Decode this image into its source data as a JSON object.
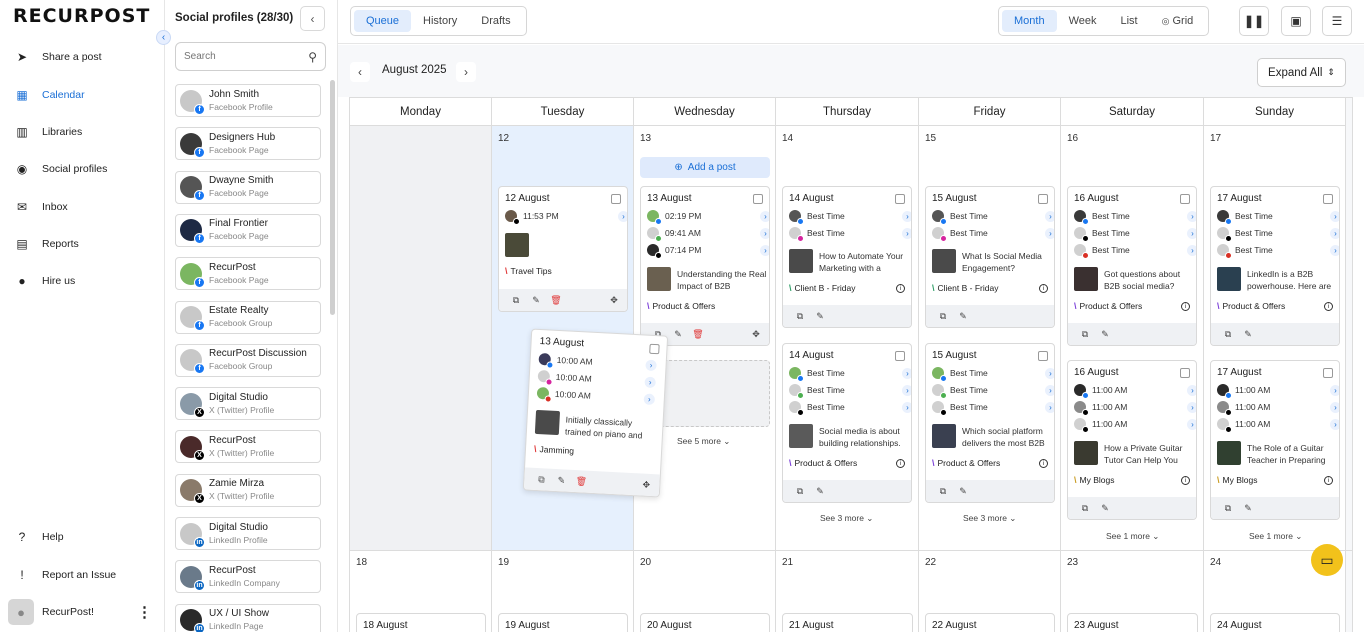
{
  "app": {
    "logo": "RECURPOST"
  },
  "nav": {
    "items": [
      {
        "label": "Share a post",
        "icon": "send-icon"
      },
      {
        "label": "Calendar",
        "icon": "calendar-icon"
      },
      {
        "label": "Libraries",
        "icon": "library-icon"
      },
      {
        "label": "Social profiles",
        "icon": "profile-icon"
      },
      {
        "label": "Inbox",
        "icon": "inbox-icon"
      },
      {
        "label": "Reports",
        "icon": "reports-icon"
      },
      {
        "label": "Hire us",
        "icon": "person-icon"
      }
    ],
    "bottom": [
      {
        "label": "Help",
        "icon": "help-icon"
      },
      {
        "label": "Report an Issue",
        "icon": "report-issue-icon"
      }
    ],
    "user": "RecurPost!",
    "accent": "#1a6fd6"
  },
  "profiles": {
    "title": "Social profiles (28/30)",
    "search_placeholder": "Search",
    "items": [
      {
        "name": "John Smith",
        "type": "Facebook Profile"
      },
      {
        "name": "Designers Hub",
        "type": "Facebook Page"
      },
      {
        "name": "Dwayne Smith",
        "type": "Facebook Page"
      },
      {
        "name": "Final Frontier",
        "type": "Facebook Page"
      },
      {
        "name": "RecurPost",
        "type": "Facebook Page"
      },
      {
        "name": "Estate Realty",
        "type": "Facebook Group"
      },
      {
        "name": "RecurPost Discussion",
        "type": "Facebook Group"
      },
      {
        "name": "Digital Studio",
        "type": "X (Twitter) Profile"
      },
      {
        "name": "RecurPost",
        "type": "X (Twitter) Profile"
      },
      {
        "name": "Zamie Mirza",
        "type": "X (Twitter) Profile"
      },
      {
        "name": "Digital Studio",
        "type": "LinkedIn Profile"
      },
      {
        "name": "RecurPost",
        "type": "LinkedIn Company"
      },
      {
        "name": "UX / UI Show",
        "type": "LinkedIn Page"
      }
    ]
  },
  "topbar": {
    "tabs": [
      "Queue",
      "History",
      "Drafts"
    ],
    "views": [
      "Month",
      "Week",
      "List",
      "Grid"
    ]
  },
  "calendar": {
    "month_label": "August 2025",
    "expand_label": "Expand All",
    "days": [
      "Monday",
      "Tuesday",
      "Wednesday",
      "Thursday",
      "Friday",
      "Saturday",
      "Sunday"
    ],
    "week1_nums": [
      "",
      "12",
      "13",
      "14",
      "15",
      "16",
      "17"
    ],
    "week2_nums": [
      "18",
      "19",
      "20",
      "21",
      "22",
      "23",
      "24"
    ],
    "add_post": "Add a post",
    "best_time": "Best Time",
    "cards": {
      "tue": {
        "date": "12 August",
        "time": "11:53 PM",
        "lib": "Travel Tips"
      },
      "wed": {
        "date": "13 August",
        "times": [
          "02:19 PM",
          "09:41 AM",
          "07:14 PM"
        ],
        "text": "Understanding the Real Impact of B2B",
        "lib": "Product & Offers",
        "see_more": "See 5 more"
      },
      "thu1": {
        "date": "14 August",
        "text": "How to Automate Your Marketing with a",
        "lib": "Client B - Friday"
      },
      "fri1": {
        "date": "15 August",
        "text": "What Is Social Media Engagement?",
        "lib": "Client B - Friday"
      },
      "sat1": {
        "date": "16 August",
        "text": "Got questions about B2B social media?",
        "lib": "Product & Offers"
      },
      "sun1": {
        "date": "17 August",
        "text": "LinkedIn is a B2B powerhouse. Here are",
        "lib": "Product & Offers"
      },
      "thu2": {
        "date": "14 August",
        "text": "Social media is about building relationships.",
        "lib": "Product & Offers",
        "see_more": "See 3 more"
      },
      "fri2": {
        "date": "15 August",
        "text": "Which social platform delivers the most B2B",
        "lib": "Product & Offers",
        "see_more": "See 3 more"
      },
      "sat2": {
        "date": "16 August",
        "time": "11:00 AM",
        "text": "How a Private Guitar Tutor Can Help You",
        "lib": "My Blogs",
        "see_more": "See 1 more"
      },
      "sun2": {
        "date": "17 August",
        "time": "11:00 AM",
        "text": "The Role of a Guitar Teacher in Preparing",
        "lib": "My Blogs",
        "see_more": "See 1 more"
      },
      "drag": {
        "date": "13 August",
        "time": "10:00 AM",
        "text": "Initially classically trained on piano and",
        "lib": "Jamming"
      }
    },
    "week2_cards": [
      "18 August",
      "19 August",
      "20 August",
      "21 August",
      "22 August",
      "23 August",
      "24 August"
    ]
  }
}
